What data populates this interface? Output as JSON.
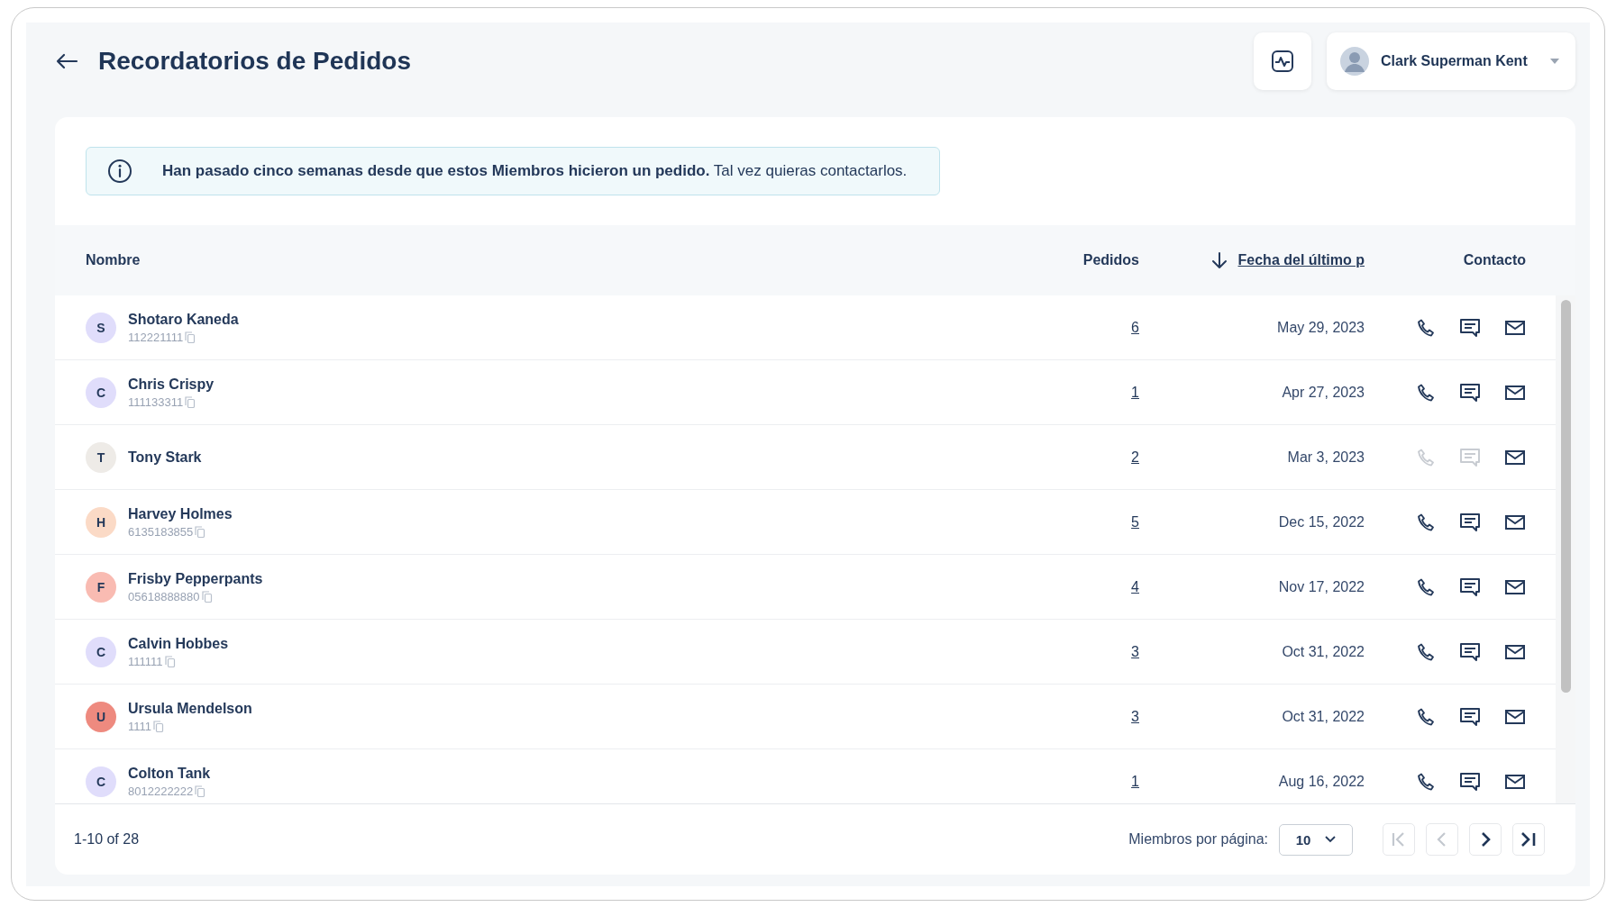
{
  "header": {
    "title": "Recordatorios de Pedidos",
    "user": {
      "name": "Clark Superman Kent"
    }
  },
  "notice": {
    "text": "**Han pasado cinco semanas desde que estos Miembros hicieron un pedido.** Tal vez quieras contactarlos."
  },
  "table": {
    "columns": [
      {
        "label": "Nombre",
        "sorted": false
      },
      {
        "label": "Pedidos",
        "sorted": false
      },
      {
        "label": "Fecha del último p",
        "sorted": true
      },
      {
        "label": "Contacto",
        "sorted": false
      }
    ],
    "rows": [
      {
        "initial": "S",
        "color": "#e0ddfb",
        "name": "Shotaro Kaneda",
        "phone": "112221111",
        "orders": "6",
        "date": "May 29, 2023",
        "phone_enabled": true,
        "sms_enabled": true,
        "email_enabled": true
      },
      {
        "initial": "C",
        "color": "#e0ddfb",
        "name": "Chris Crispy",
        "phone": "111133311",
        "orders": "1",
        "date": "Apr 27, 2023",
        "phone_enabled": true,
        "sms_enabled": true,
        "email_enabled": true
      },
      {
        "initial": "T",
        "color": "#eeebe7",
        "name": "Tony Stark",
        "orders": "2",
        "date": "Mar 3, 2023",
        "phone_enabled": false,
        "sms_enabled": false,
        "email_enabled": true
      },
      {
        "initial": "H",
        "color": "#fbdac6",
        "name": "Harvey Holmes",
        "phone": "6135183855",
        "orders": "5",
        "date": "Dec 15, 2022",
        "phone_enabled": true,
        "sms_enabled": true,
        "email_enabled": true
      },
      {
        "initial": "F",
        "color": "#f9bbb2",
        "name": "Frisby Pepperpants",
        "phone": "05618888880",
        "orders": "4",
        "date": "Nov 17, 2022",
        "phone_enabled": true,
        "sms_enabled": true,
        "email_enabled": true
      },
      {
        "initial": "C",
        "color": "#e0ddfb",
        "name": "Calvin Hobbes",
        "phone": "111111",
        "orders": "3",
        "date": "Oct 31, 2022",
        "phone_enabled": true,
        "sms_enabled": true,
        "email_enabled": true
      },
      {
        "initial": "U",
        "color": "#ee8a7f",
        "name": "Ursula Mendelson",
        "phone": "1111",
        "orders": "3",
        "date": "Oct 31, 2022",
        "phone_enabled": true,
        "sms_enabled": true,
        "email_enabled": true
      },
      {
        "initial": "C",
        "color": "#e0ddfb",
        "name": "Colton Tank",
        "phone": "8012222222",
        "orders": "1",
        "date": "Aug 16, 2022",
        "phone_enabled": true,
        "sms_enabled": true,
        "email_enabled": true
      }
    ]
  },
  "footer": {
    "range": "1-10 of 28",
    "per_page_label": "Miembros por página:",
    "per_page": "10",
    "pager": [
      {
        "kind": "first",
        "disabled": true
      },
      {
        "kind": "prev",
        "disabled": true
      },
      {
        "kind": "next",
        "disabled": false
      },
      {
        "kind": "last",
        "disabled": false
      }
    ]
  }
}
